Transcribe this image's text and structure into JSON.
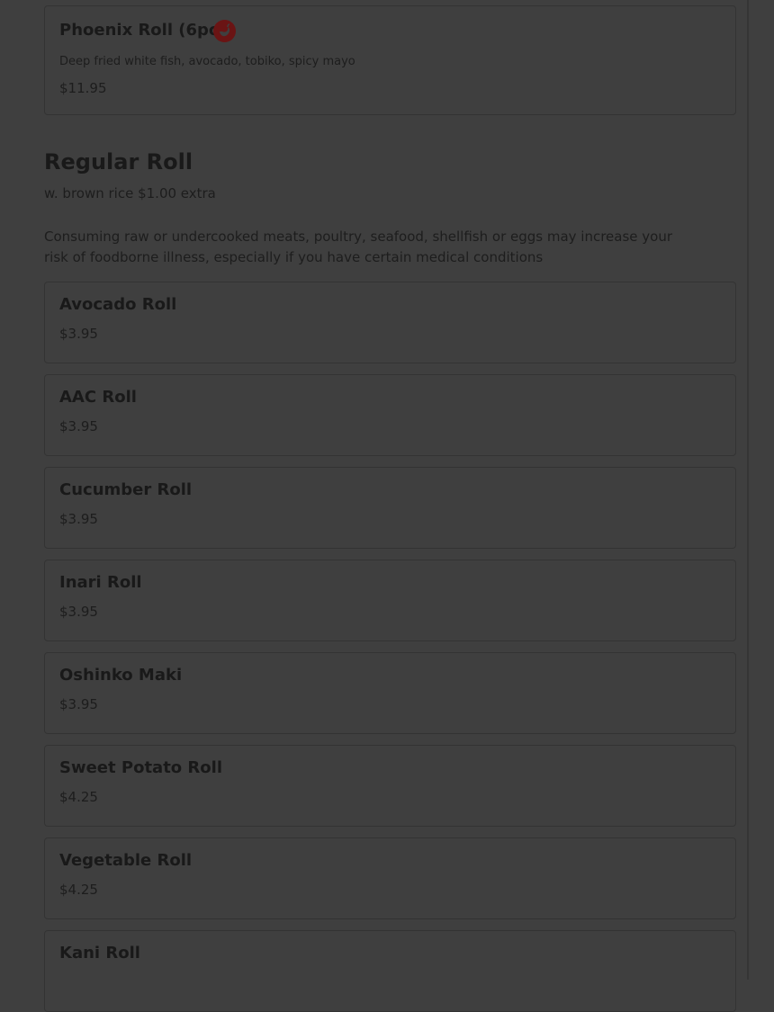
{
  "featured_item": {
    "name": "Phoenix Roll (6pcs)",
    "description": "Deep fried white fish, avocado, tobiko, spicy mayo",
    "price": "$11.95",
    "icon": "spicy-icon"
  },
  "section": {
    "title": "Regular Roll",
    "subtitle": "w. brown rice $1.00 extra",
    "warning": "Consuming raw or undercooked meats, poultry, seafood, shellfish or eggs may increase your risk of foodborne illness, especially if you have certain medical conditions"
  },
  "items": [
    {
      "name": "Avocado Roll",
      "price": "$3.95"
    },
    {
      "name": "AAC Roll",
      "price": "$3.95"
    },
    {
      "name": "Cucumber Roll",
      "price": "$3.95"
    },
    {
      "name": "Inari Roll",
      "price": "$3.95"
    },
    {
      "name": "Oshinko Maki",
      "price": "$3.95"
    },
    {
      "name": "Sweet Potato Roll",
      "price": "$4.25"
    },
    {
      "name": "Vegetable Roll",
      "price": "$4.25"
    },
    {
      "name": "Kani Roll",
      "price": ""
    }
  ],
  "colors": {
    "overlay": "#3f3f3f",
    "spicy_badge": "#6a1414"
  }
}
